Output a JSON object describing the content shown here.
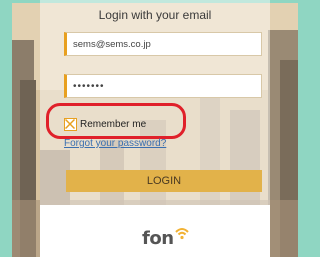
{
  "login": {
    "title": "Login with your email",
    "email_value": "sems@sems.co.jp",
    "password_mask": "•••••••",
    "remember_label": "Remember me",
    "remember_checked": true,
    "forgot_link": "Forgot your password?",
    "login_button": "LOGIN"
  },
  "brand": {
    "logo_text": "fon",
    "logo_icon": "wifi-icon"
  },
  "colors": {
    "frame": "#8fd6c2",
    "accent": "#e8a020",
    "button": "#e2b24a",
    "highlight": "#e0202a",
    "link": "#3a6fb0"
  }
}
